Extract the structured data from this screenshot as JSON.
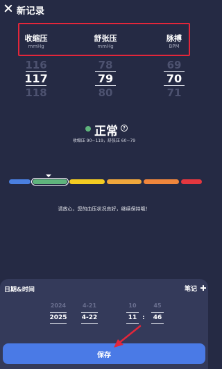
{
  "header": {
    "title": "新记录",
    "close_icon": "close-icon"
  },
  "columns": [
    {
      "label": "收缩压",
      "unit": "mmHg",
      "prev": "116",
      "value": "117",
      "next": "118"
    },
    {
      "label": "舒张压",
      "unit": "mmHg",
      "prev": "78",
      "value": "79",
      "next": "80"
    },
    {
      "label": "脉搏",
      "unit": "BPM",
      "prev": "69",
      "value": "70",
      "next": "71"
    }
  ],
  "status": {
    "text": "正常",
    "color": "#5fb47c",
    "help_icon": "question-icon",
    "help_glyph": "?",
    "range": "收缩压 90~119，舒张压 60~79"
  },
  "scale": {
    "colors": [
      "#4a7fe0",
      "#5fb47c",
      "#f4cc22",
      "#f0a73c",
      "#f0863c",
      "#e4373f"
    ],
    "active_index": 1
  },
  "advice": "请放心，您的血压状况良好，继续保持哦！",
  "sheet": {
    "datetime_label": "日期&时间",
    "note_label": "笔记",
    "note_icon": "plus-icon",
    "year": {
      "prev": "2024",
      "value": "2025"
    },
    "date": {
      "prev": "4-21",
      "value": "4-22"
    },
    "hour": {
      "prev": "10",
      "value": "11"
    },
    "minute": {
      "prev": "45",
      "value": "46"
    },
    "separator": ":"
  },
  "save_label": "保存",
  "colors": {
    "background": "#252a44",
    "sheet": "#343a5a",
    "accent": "#4a7ae6",
    "highlight": "#e3263a"
  }
}
